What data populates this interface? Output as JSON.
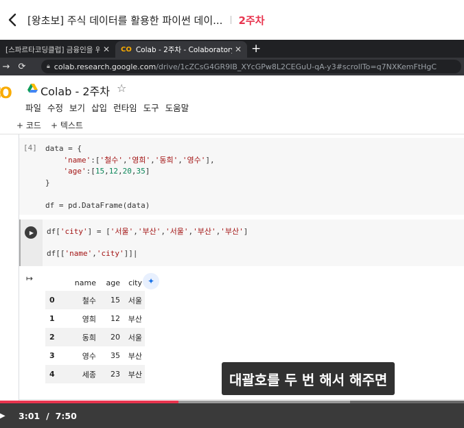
{
  "header": {
    "title": "[왕초보] 주식 데이터를 활용한 파이썬 데이...",
    "week": "2주차"
  },
  "browser": {
    "tabs": [
      {
        "label": "[스파르타코딩클럽] 금융인을 위"
      },
      {
        "label": "Colab - 2주차 - Colaboratory",
        "favicon": "CO"
      }
    ],
    "url_host": "colab.research.google.com",
    "url_path": "/drive/1cZCsG4GR9IB_XYcGPw8L2CEGuU-qA-y3#scrollTo=q7NXKemFtHgC"
  },
  "colab": {
    "logo": "CO",
    "title": "Colab - 2주차",
    "menu": [
      "파일",
      "수정",
      "보기",
      "삽입",
      "런타임",
      "도구",
      "도움말"
    ],
    "add_code": "+ 코드",
    "add_text": "+ 텍스트"
  },
  "cells": {
    "cell1_count": "[4]"
  },
  "output": {
    "columns": [
      "name",
      "age",
      "city"
    ],
    "rows": [
      {
        "idx": "0",
        "name": "철수",
        "age": "15",
        "city": "서울"
      },
      {
        "idx": "1",
        "name": "영희",
        "age": "12",
        "city": "부산"
      },
      {
        "idx": "2",
        "name": "동희",
        "age": "20",
        "city": "서울"
      },
      {
        "idx": "3",
        "name": "영수",
        "age": "35",
        "city": "부산"
      },
      {
        "idx": "4",
        "name": "세종",
        "age": "23",
        "city": "부산"
      }
    ]
  },
  "subtitle": "대괄호를 두 번 해서 해주면",
  "player": {
    "current_time": "3:01",
    "separator": "/",
    "duration": "7:50",
    "progress_fraction": 0.385,
    "buffered_fraction": 0.755
  },
  "colors": {
    "accent": "#e8344e",
    "colab_orange": "#f9ab00"
  }
}
